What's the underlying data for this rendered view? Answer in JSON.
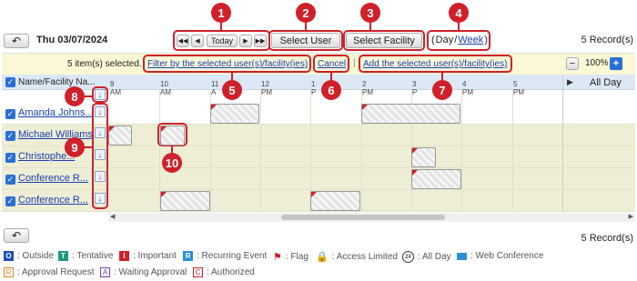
{
  "toolbar": {
    "date": "Thu 03/07/2024",
    "today": "Today",
    "select_user": "Select User",
    "select_facility": "Select Facility",
    "view_open": "(",
    "view_day": "Day",
    "view_sep": "/",
    "view_week": "Week",
    "view_close": ")",
    "records": "5 Record(s)"
  },
  "selection_bar": {
    "selected_text": "5 item(s) selected.",
    "filter_link": "Filter by the selected user(s)/facility(ies)",
    "cancel_link": "Cancel",
    "separator": "|",
    "add_link": "Add the selected user(s)/facility(ies)",
    "zoom_minus": "−",
    "zoom": "100%",
    "zoom_plus": "+"
  },
  "grid": {
    "header_label": "Name/Facility Na...",
    "hours": [
      "9 AM",
      "10 AM",
      "11 A",
      "12 PM",
      "1 P",
      "2 PM",
      "3 P",
      "4 PM",
      "5 PM"
    ],
    "all_day": "All Day",
    "rows": [
      {
        "name": "Amanda Johns..."
      },
      {
        "name": "Michael Williams"
      },
      {
        "name": "Christophe..."
      },
      {
        "name": "Conference R..."
      },
      {
        "name": "Conference R..."
      }
    ]
  },
  "annotations": [
    "1",
    "2",
    "3",
    "4",
    "5",
    "6",
    "7",
    "8",
    "9",
    "10"
  ],
  "bottom_records": "5 Record(s)",
  "legend": [
    {
      "key": "O",
      "label": ": Outside",
      "color": "#1f4fb0"
    },
    {
      "key": "T",
      "label": ": Tentative",
      "color": "#1a9a7a"
    },
    {
      "key": "I",
      "label": ": Important",
      "color": "#d0202a"
    },
    {
      "key": "R",
      "label": ": Recurring Event",
      "color": "#2a8fd4"
    },
    {
      "label": ": Flag",
      "icon": "flag-icon"
    },
    {
      "label": ": Access Limited",
      "icon": "lock-icon"
    },
    {
      "label": ": All Day",
      "icon": "24-icon",
      "glyph": "24"
    },
    {
      "label": ": Web Conference",
      "icon": "video-icon"
    }
  ],
  "legend2": [
    {
      "key": "R",
      "label": ": Approval Request",
      "color": "#e08a2a"
    },
    {
      "key": "A",
      "label": ": Waiting Approval",
      "color": "#7a3fb0"
    },
    {
      "key": "C",
      "label": ": Authorized",
      "color": "#d0202a"
    }
  ]
}
